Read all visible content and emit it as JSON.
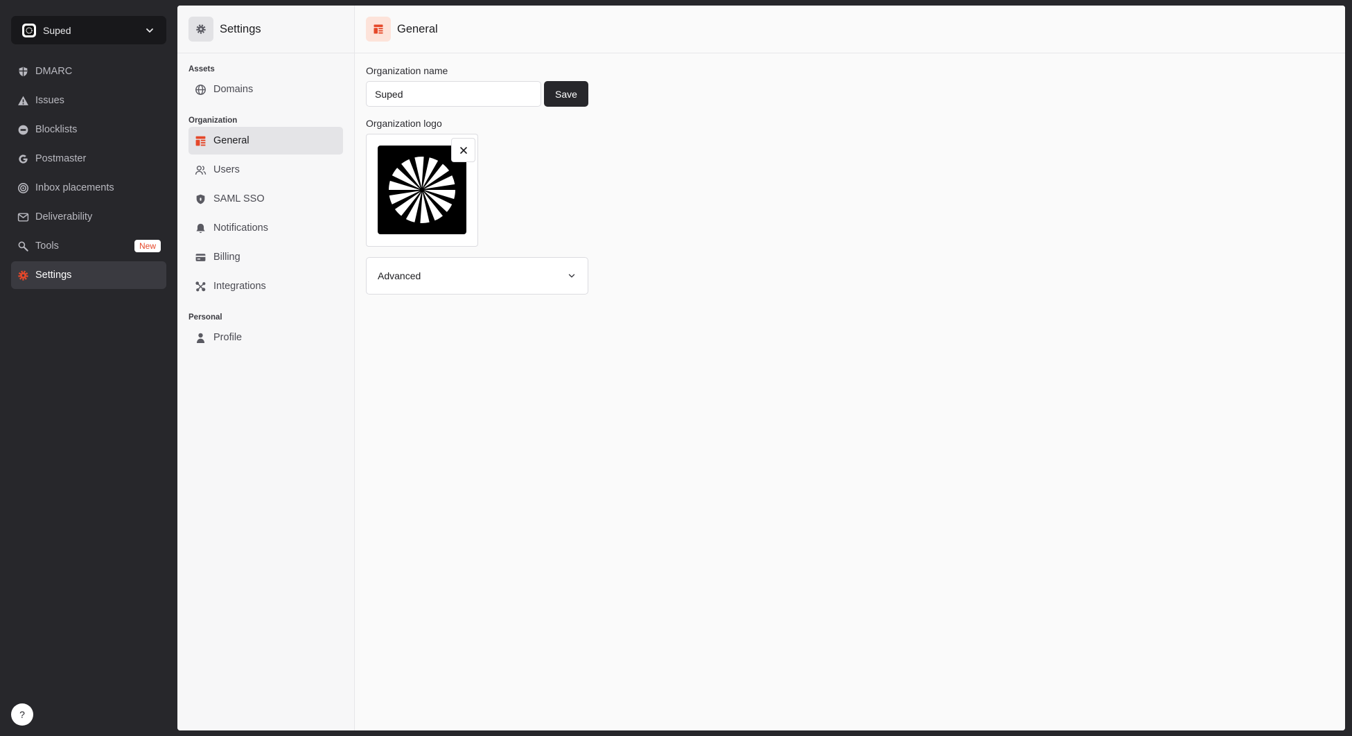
{
  "workspace": {
    "name": "Suped"
  },
  "nav": {
    "items": [
      {
        "label": "DMARC",
        "icon": "shield-icon"
      },
      {
        "label": "Issues",
        "icon": "warning-icon"
      },
      {
        "label": "Blocklists",
        "icon": "block-icon"
      },
      {
        "label": "Postmaster",
        "icon": "google-icon"
      },
      {
        "label": "Inbox placements",
        "icon": "target-icon"
      },
      {
        "label": "Deliverability",
        "icon": "mail-check-icon"
      },
      {
        "label": "Tools",
        "icon": "wrench-icon",
        "badge": "New"
      },
      {
        "label": "Settings",
        "icon": "gear-icon",
        "active": true
      }
    ],
    "help_label": "?"
  },
  "settings": {
    "title": "Settings",
    "groups": [
      {
        "label": "Assets",
        "items": [
          {
            "label": "Domains",
            "icon": "globe-icon"
          }
        ]
      },
      {
        "label": "Organization",
        "items": [
          {
            "label": "General",
            "icon": "layout-icon",
            "active": true
          },
          {
            "label": "Users",
            "icon": "users-icon"
          },
          {
            "label": "SAML SSO",
            "icon": "shield-lock-icon"
          },
          {
            "label": "Notifications",
            "icon": "bell-icon"
          },
          {
            "label": "Billing",
            "icon": "card-icon"
          },
          {
            "label": "Integrations",
            "icon": "integrations-icon"
          }
        ]
      },
      {
        "label": "Personal",
        "items": [
          {
            "label": "Profile",
            "icon": "person-icon"
          }
        ]
      }
    ]
  },
  "content": {
    "title": "General",
    "org_name_label": "Organization name",
    "org_name_value": "Suped",
    "save_label": "Save",
    "org_logo_label": "Organization logo",
    "advanced_label": "Advanced"
  },
  "colors": {
    "accent": "#e5482a",
    "sidebar_bg": "#27272b",
    "active_bg": "#3a3a40"
  }
}
